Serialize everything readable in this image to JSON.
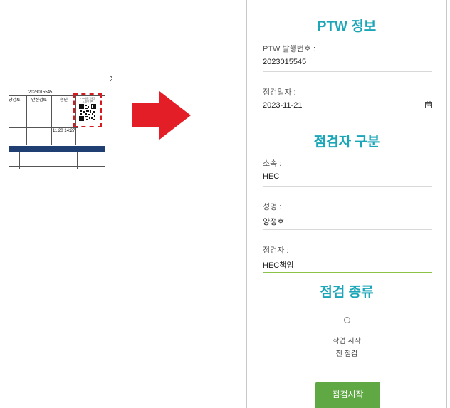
{
  "document_snippet": {
    "permit_number": "2023015545",
    "headers": [
      "당검토",
      "안전검토",
      "승인"
    ],
    "qr_caption": "PTW점검 고유코드 입력 QR",
    "timestamp": "11.20 14:27",
    "highlight_color": "#d71920",
    "band_color": "#1f3f73"
  },
  "arrow": {
    "color": "#e41e26"
  },
  "form": {
    "ptw_section_title": "PTW 정보",
    "permit_label": "PTW 발행번호 :",
    "permit_value": "2023015545",
    "date_label": "점검일자 :",
    "date_value": "2023-11-21",
    "inspector_section_title": "점검자 구분",
    "affiliation_label": "소속 :",
    "affiliation_value": "HEC",
    "name_label": "성명 :",
    "name_value": "양정호",
    "inspector_label": "점검자 :",
    "inspector_value": "HEC책임",
    "type_section_title": "점검 종류",
    "option_label_line1": "작업 시작",
    "option_label_line2": "전 점검",
    "start_button": "점검시작",
    "accent_color": "#1ba6b8",
    "button_color": "#5fa843"
  }
}
